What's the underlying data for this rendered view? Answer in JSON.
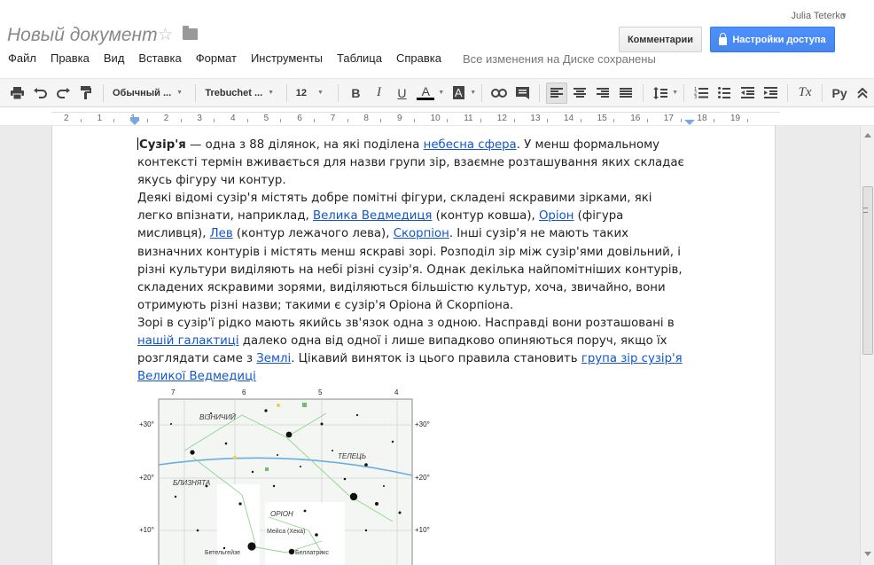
{
  "header": {
    "doc_title": "Новый документ",
    "user_name": "Julia Teterko",
    "comments_label": "Комментарии",
    "share_label": "Настройки доступа",
    "save_status": "Все изменения на Диске сохранены"
  },
  "menu": [
    "Файл",
    "Правка",
    "Вид",
    "Вставка",
    "Формат",
    "Инструменты",
    "Таблица",
    "Справка"
  ],
  "toolbar": {
    "style_select": "Обычный ...",
    "font_select": "Trebuchet ...",
    "size_select": "12",
    "bold": "B",
    "italic": "I",
    "underline": "U",
    "text_color": "A",
    "highlight": "A",
    "clear_format": "Tx",
    "input_tools": "Ру",
    "accent": "#4d90fe"
  },
  "ruler": [
    "2",
    "1",
    "1",
    "2",
    "3",
    "4",
    "5",
    "6",
    "7",
    "8",
    "9",
    "10",
    "11",
    "12",
    "13",
    "14",
    "15",
    "16",
    "17",
    "18",
    "19"
  ],
  "body": {
    "p1": {
      "term": "Сузір'я",
      "t1": " — одна з 88 ділянок, на які поділена ",
      "link1": "небесна сфера",
      "t2": ". У менш формальному контексті термін вживається для назви групи зір, взаємне розташування яких складає якусь фігуру чи контур."
    },
    "p2": {
      "t1": "Деякі відомі сузір'я містять добре помітні фігури, складені яскравими зірками, які легко впізнати, наприклад, ",
      "link1": "Велика Ведмедиця",
      "t2": " (контур ковша), ",
      "link2": "Оріон",
      "t3": " (фігура мисливця), ",
      "link3": "Лев",
      "t4": " (контур лежачого лева), ",
      "link4": "Скорпіон",
      "t5": ". Інші сузір'я не мають таких визначних контурів і містять менш яскраві зорі. Розподіл зір між сузір'ями довільний, і різні культури виділяють на небі різні сузір'я. Однак декілька найпомітніших контурів, складених яскравими зорями, виділяються більшістю культур, хоча, звичайно, вони отримують різні назви; такими є сузір'я Оріона й Скорпіона."
    },
    "p3": {
      "t1": "Зорі в сузір'ї рідко мають якийсь зв'язок одна з одною. Насправді вони розташовані в ",
      "link1": "нашій галактиці",
      "t2": " далеко одна від одної і лише випадково опиняються поруч, якщо їх розглядати саме з ",
      "link2": "Землі",
      "t3": ". Цікавий виняток із цього правила становить ",
      "link3": "група зір сузір'я Великої Ведмедиці"
    }
  },
  "star_map": {
    "top_labels": [
      "7",
      "6",
      "5",
      "4"
    ],
    "left_labels": [
      "+30°",
      "+20°",
      "+10°"
    ],
    "right_labels": [
      "+30°",
      "+20°",
      "+10°"
    ],
    "constellations": [
      "ВІЗНИЧИЙ",
      "ТЕЛЕЦЬ",
      "БЛИЗНЯТА",
      "ОРІОН"
    ],
    "stars": [
      "Мейса (Хека)",
      "Бетельгейзе",
      "Беллатрикс"
    ]
  }
}
